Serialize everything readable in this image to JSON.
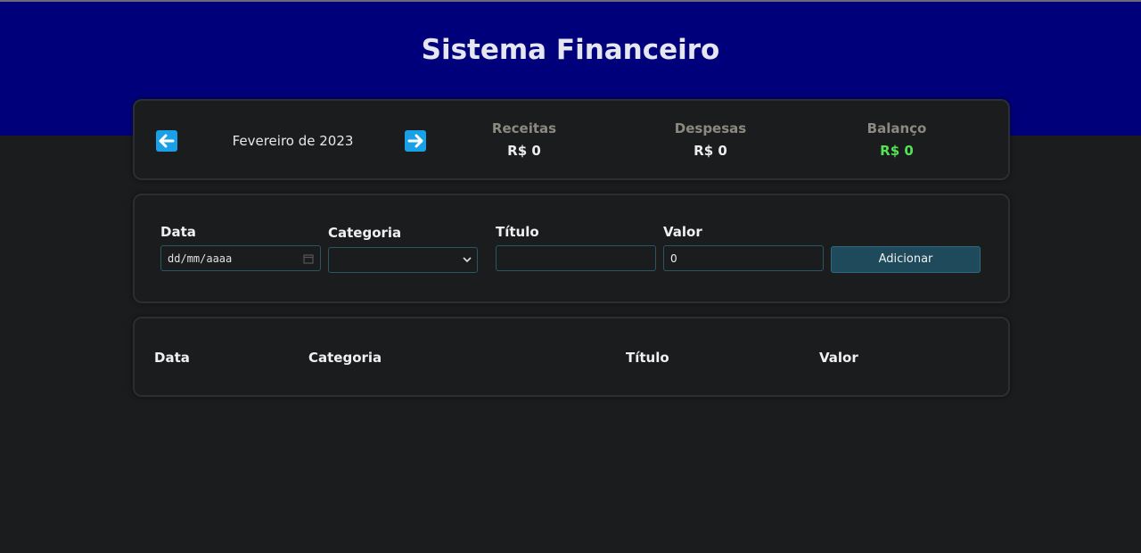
{
  "header": {
    "title": "Sistema Financeiro"
  },
  "info": {
    "month": "Fevereiro de 2023",
    "receitas": {
      "label": "Receitas",
      "value": "R$ 0"
    },
    "despesas": {
      "label": "Despesas",
      "value": "R$ 0"
    },
    "balanco": {
      "label": "Balanço",
      "value": "R$ 0",
      "color": "#52e452"
    }
  },
  "form": {
    "data_label": "Data",
    "date_placeholder": "dd/mm/aaaa",
    "categoria_label": "Categoria",
    "categoria_value": "",
    "titulo_label": "Título",
    "titulo_value": "",
    "valor_label": "Valor",
    "valor_value": "0",
    "add_label": "Adicionar"
  },
  "table": {
    "columns": [
      "Data",
      "Categoria",
      "Título",
      "Valor"
    ],
    "rows": []
  },
  "colors": {
    "header_bg": "#00007a",
    "page_bg": "#1b1c1e",
    "accent": "#1aa0e6",
    "button_bg": "#1f4a5b"
  }
}
